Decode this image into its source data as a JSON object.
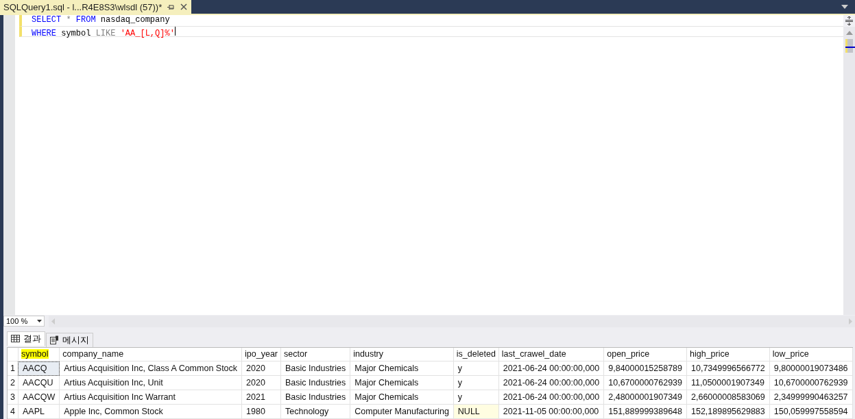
{
  "document_tab": {
    "title": "SQLQuery1.sql - l...R4E8S3\\wlsdl (57))*"
  },
  "editor": {
    "lines": [
      [
        {
          "kind": "keyword",
          "text": "SELECT"
        },
        {
          "kind": "operator",
          "text": "*"
        },
        {
          "kind": "keyword",
          "text": "FROM"
        },
        {
          "kind": "plain",
          "text": "nasdaq_company"
        }
      ],
      [
        {
          "kind": "keyword",
          "text": "WHERE"
        },
        {
          "kind": "plain",
          "text": "symbol"
        },
        {
          "kind": "operator",
          "text": "LIKE"
        },
        {
          "kind": "string",
          "text": "'AA_[L,Q]%'"
        }
      ]
    ]
  },
  "zoom": {
    "value": "100 %"
  },
  "result_tabs": [
    {
      "label": "결과",
      "selected": true
    },
    {
      "label": "메시지",
      "selected": false
    }
  ],
  "grid": {
    "columns": [
      {
        "label": "symbol",
        "highlighted": true
      },
      {
        "label": "company_name",
        "highlighted": false
      },
      {
        "label": "ipo_year",
        "highlighted": false
      },
      {
        "label": "sector",
        "highlighted": false
      },
      {
        "label": "industry",
        "highlighted": false
      },
      {
        "label": "is_deleted",
        "highlighted": false
      },
      {
        "label": "last_crawel_date",
        "highlighted": false
      },
      {
        "label": "open_price",
        "highlighted": false
      },
      {
        "label": "high_price",
        "highlighted": false
      },
      {
        "label": "low_price",
        "highlighted": false
      }
    ],
    "rows": [
      {
        "number": "1",
        "cells": [
          {
            "text": "AACQ",
            "focused": true
          },
          "Artius Acquisition Inc, Class A Common Stock",
          "2020",
          "Basic Industries",
          "Major Chemicals",
          "y",
          "2021-06-24 00:00:00,000",
          "9,84000015258789",
          "10,7349996566772",
          "9,80000019073486"
        ]
      },
      {
        "number": "2",
        "cells": [
          "AACQU",
          "Artius Acquisition Inc, Unit",
          "2020",
          "Basic Industries",
          "Major Chemicals",
          "y",
          "2021-06-24 00:00:00,000",
          "10,6700000762939",
          "11,0500001907349",
          "10,6700000762939"
        ]
      },
      {
        "number": "3",
        "cells": [
          "AACQW",
          "Artius Acquisition Inc Warrant",
          "2021",
          "Basic Industries",
          "Major Chemicals",
          "y",
          "2021-06-24 00:00:00,000",
          "2,48000001907349",
          "2,66000008583069",
          "2,34999990463257"
        ]
      },
      {
        "number": "4",
        "cells": [
          "AAPL",
          "Apple Inc, Common Stock",
          "1980",
          "Technology",
          "Computer Manufacturing",
          {
            "text": "NULL",
            "null": true
          },
          "2021-11-05 00:00:00,000",
          "151,889999389648",
          "152,189895629883",
          "150,059997558594"
        ]
      }
    ]
  }
}
